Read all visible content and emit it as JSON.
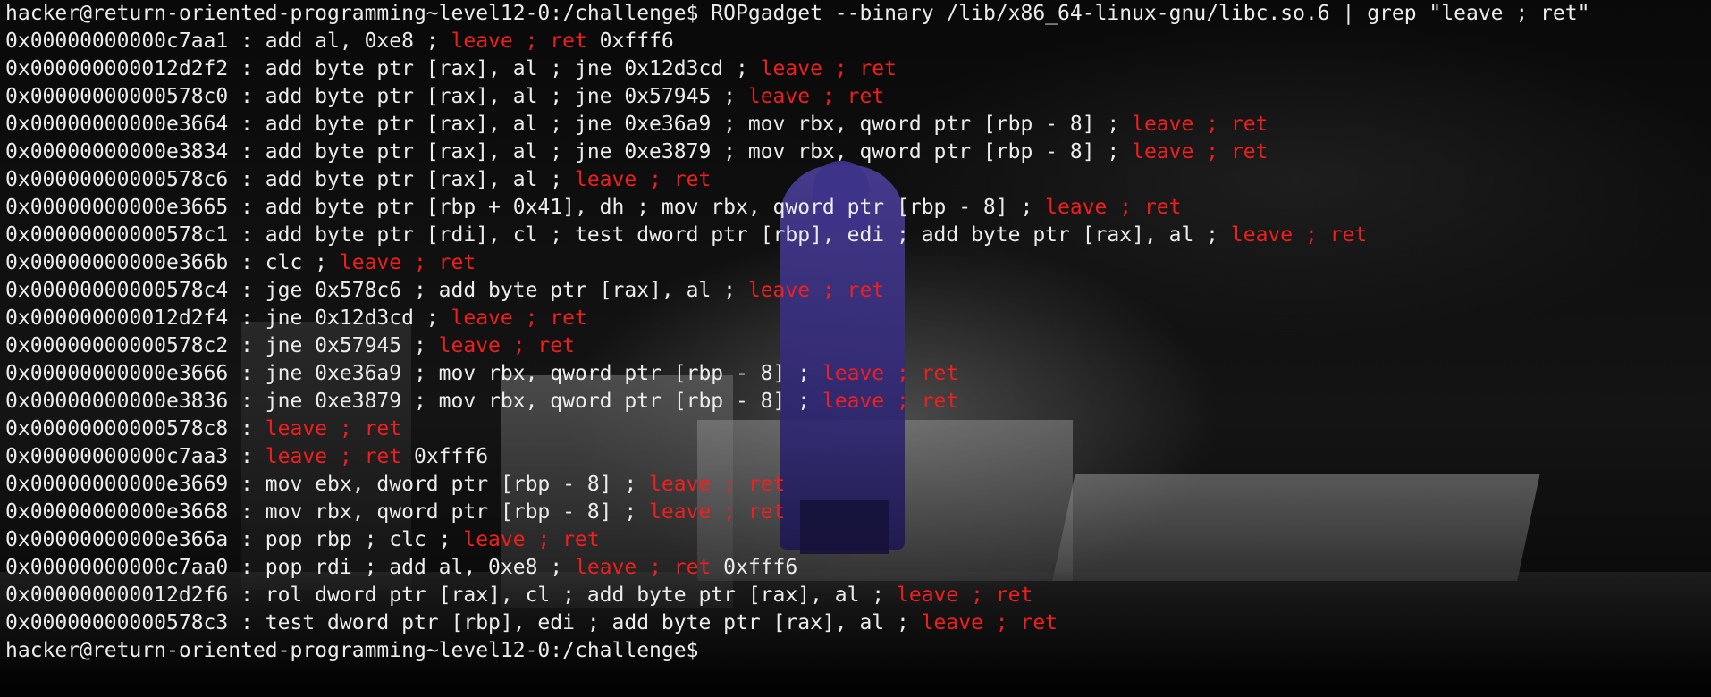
{
  "terminal": {
    "prompt": "hacker@return-oriented-programming~level12-0:/challenge$",
    "command": " ROPgadget --binary /lib/x86_64-linux-gnu/libc.so.6 | grep \"leave ; ret\"",
    "final_prompt": "hacker@return-oriented-programming~level12-0:/challenge$",
    "highlight_color": "#f01f1f",
    "text_color": "#ececec",
    "background_color": "#0c0c0c",
    "gadgets": [
      {
        "pre": "0x00000000000c7aa1 : add al, 0xe8 ; ",
        "hl": "leave ; ret",
        "post": " 0xfff6"
      },
      {
        "pre": "0x000000000012d2f2 : add byte ptr [rax], al ; jne 0x12d3cd ; ",
        "hl": "leave ; ret",
        "post": ""
      },
      {
        "pre": "0x00000000000578c0 : add byte ptr [rax], al ; jne 0x57945 ; ",
        "hl": "leave ; ret",
        "post": ""
      },
      {
        "pre": "0x00000000000e3664 : add byte ptr [rax], al ; jne 0xe36a9 ; mov rbx, qword ptr [rbp - 8] ; ",
        "hl": "leave ; ret",
        "post": ""
      },
      {
        "pre": "0x00000000000e3834 : add byte ptr [rax], al ; jne 0xe3879 ; mov rbx, qword ptr [rbp - 8] ; ",
        "hl": "leave ; ret",
        "post": ""
      },
      {
        "pre": "0x00000000000578c6 : add byte ptr [rax], al ; ",
        "hl": "leave ; ret",
        "post": ""
      },
      {
        "pre": "0x00000000000e3665 : add byte ptr [rbp + 0x41], dh ; mov rbx, qword ptr [rbp - 8] ; ",
        "hl": "leave ; ret",
        "post": ""
      },
      {
        "pre": "0x00000000000578c1 : add byte ptr [rdi], cl ; test dword ptr [rbp], edi ; add byte ptr [rax], al ; ",
        "hl": "leave ; ret",
        "post": ""
      },
      {
        "pre": "0x00000000000e366b : clc ; ",
        "hl": "leave ; ret",
        "post": ""
      },
      {
        "pre": "0x00000000000578c4 : jge 0x578c6 ; add byte ptr [rax], al ; ",
        "hl": "leave ; ret",
        "post": ""
      },
      {
        "pre": "0x000000000012d2f4 : jne 0x12d3cd ; ",
        "hl": "leave ; ret",
        "post": ""
      },
      {
        "pre": "0x00000000000578c2 : jne 0x57945 ; ",
        "hl": "leave ; ret",
        "post": ""
      },
      {
        "pre": "0x00000000000e3666 : jne 0xe36a9 ; mov rbx, qword ptr [rbp - 8] ; ",
        "hl": "leave ; ret",
        "post": ""
      },
      {
        "pre": "0x00000000000e3836 : jne 0xe3879 ; mov rbx, qword ptr [rbp - 8] ; ",
        "hl": "leave ; ret",
        "post": ""
      },
      {
        "pre": "0x00000000000578c8 : ",
        "hl": "leave ; ret",
        "post": ""
      },
      {
        "pre": "0x00000000000c7aa3 : ",
        "hl": "leave ; ret",
        "post": " 0xfff6"
      },
      {
        "pre": "0x00000000000e3669 : mov ebx, dword ptr [rbp - 8] ; ",
        "hl": "leave ; ret",
        "post": ""
      },
      {
        "pre": "0x00000000000e3668 : mov rbx, qword ptr [rbp - 8] ; ",
        "hl": "leave ; ret",
        "post": ""
      },
      {
        "pre": "0x00000000000e366a : pop rbp ; clc ; ",
        "hl": "leave ; ret",
        "post": ""
      },
      {
        "pre": "0x00000000000c7aa0 : pop rdi ; add al, 0xe8 ; ",
        "hl": "leave ; ret",
        "post": " 0xfff6"
      },
      {
        "pre": "0x000000000012d2f6 : rol dword ptr [rax], cl ; add byte ptr [rax], al ; ",
        "hl": "leave ; ret",
        "post": ""
      },
      {
        "pre": "0x00000000000578c3 : test dword ptr [rbp], edi ; add byte ptr [rax], al ; ",
        "hl": "leave ; ret",
        "post": ""
      }
    ]
  }
}
